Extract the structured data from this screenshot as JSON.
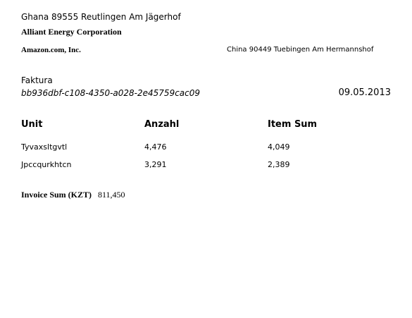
{
  "sender": {
    "address": "Ghana 89555 Reutlingen Am Jägerhof",
    "company": "Alliant Energy Corporation"
  },
  "recipient": {
    "company": "Amazon.com, Inc.",
    "address": "China 90449 Tuebingen Am Hermannshof"
  },
  "document": {
    "title": "Faktura",
    "id": "bb936dbf-c108-4350-a028-2e45759cac09",
    "date": "09.05.2013"
  },
  "table": {
    "headers": [
      "Unit",
      "Anzahl",
      "Item Sum"
    ],
    "rows": [
      [
        "Tyvaxsltgvtl",
        "4,476",
        "4,049"
      ],
      [
        "Jpccqurkhtcn",
        "3,291",
        "2,389"
      ]
    ]
  },
  "total": {
    "label": "Invoice Sum (KZT)",
    "value": "811,450"
  }
}
